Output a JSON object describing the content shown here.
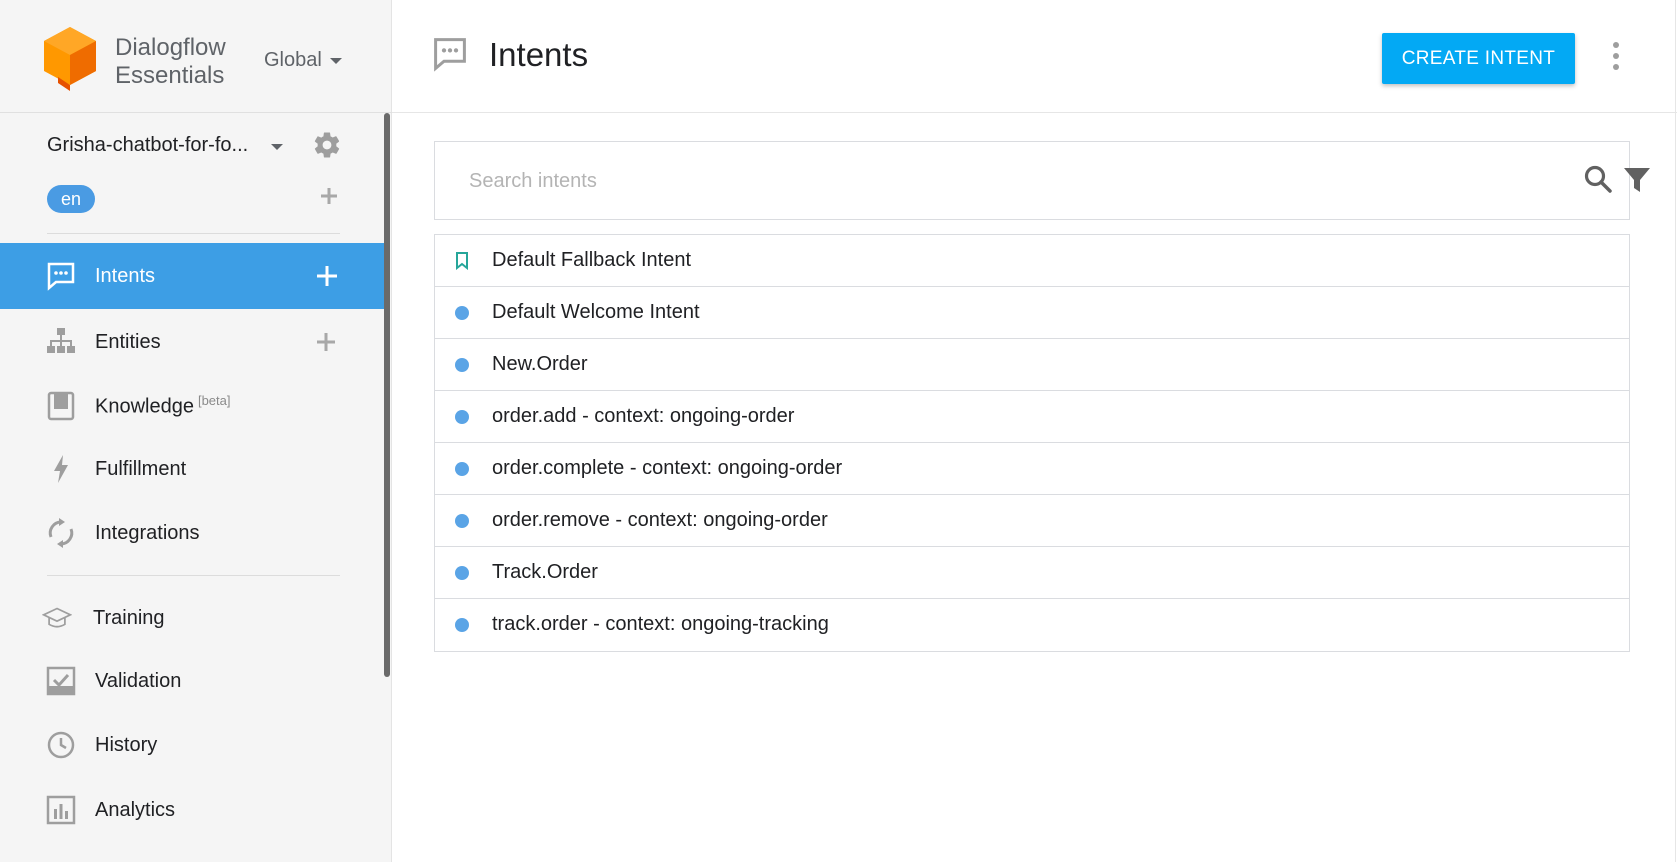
{
  "brand": {
    "name_line1": "Dialogflow",
    "name_line2": "Essentials",
    "region": "Global"
  },
  "agent": {
    "name": "Grisha-chatbot-for-fo...",
    "language": "en"
  },
  "nav": {
    "intents": "Intents",
    "entities": "Entities",
    "knowledge": "Knowledge",
    "knowledge_badge": "[beta]",
    "fulfillment": "Fulfillment",
    "integrations": "Integrations",
    "training": "Training",
    "validation": "Validation",
    "history": "History",
    "analytics": "Analytics"
  },
  "header": {
    "title": "Intents",
    "create_button": "CREATE INTENT"
  },
  "search": {
    "placeholder": "Search intents"
  },
  "intents": [
    {
      "name": "Default Fallback Intent",
      "marker": "bookmark-icon"
    },
    {
      "name": "Default Welcome Intent",
      "marker": "dot"
    },
    {
      "name": "New.Order",
      "marker": "dot"
    },
    {
      "name": "order.add - context: ongoing-order",
      "marker": "dot"
    },
    {
      "name": "order.complete - context: ongoing-order",
      "marker": "dot"
    },
    {
      "name": "order.remove - context: ongoing-order",
      "marker": "dot"
    },
    {
      "name": "Track.Order",
      "marker": "dot"
    },
    {
      "name": "track.order - context: ongoing-tracking",
      "marker": "dot"
    }
  ],
  "colors": {
    "accent": "#03a9f4",
    "active_nav": "#3d9ee5",
    "intent_dot": "#5aa4e6",
    "fallback_marker": "#26a69a",
    "logo_orange": "#ff9800"
  }
}
